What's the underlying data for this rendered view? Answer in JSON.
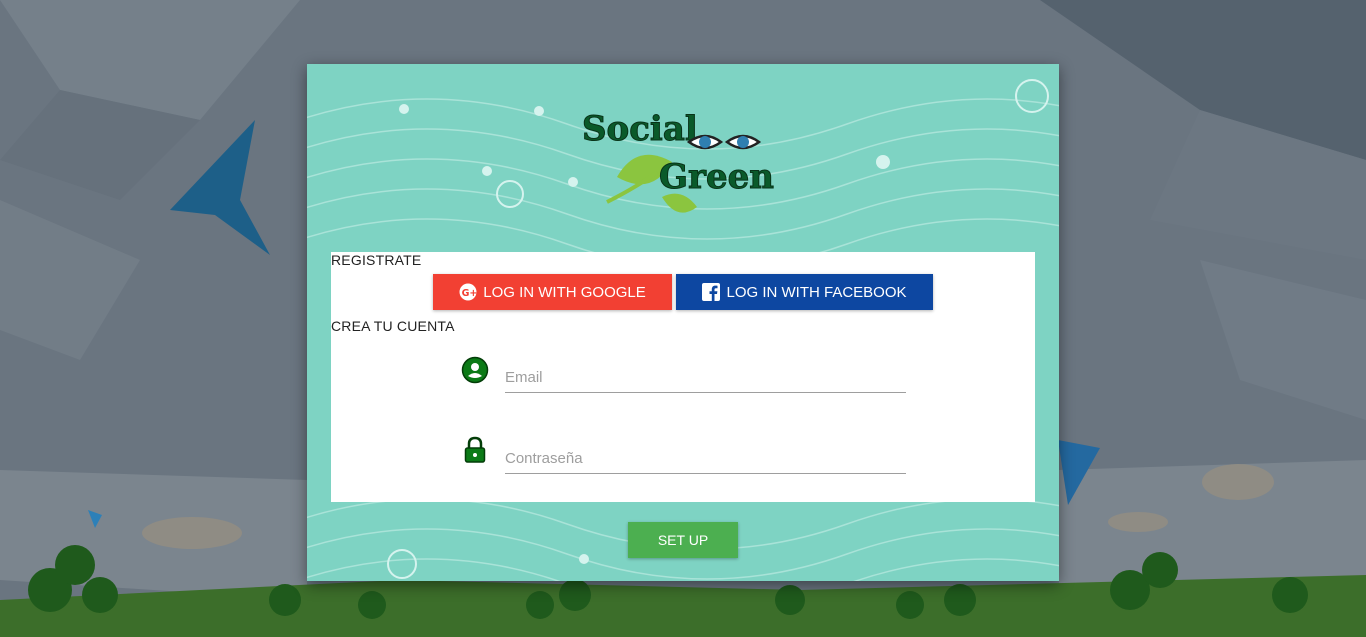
{
  "brand": {
    "line1": "Social",
    "line2": "Green"
  },
  "register": {
    "title": "REGISTRATE",
    "google_label": "LOG IN WITH GOOGLE",
    "facebook_label": "LOG IN WITH FACEBOOK",
    "google_icon": "google-plus-icon",
    "facebook_icon": "facebook-icon"
  },
  "create_account": {
    "title": "CREA TU CUENTA",
    "email": {
      "placeholder": "Email",
      "value": "",
      "icon": "account-circle-icon"
    },
    "password": {
      "placeholder": "Contraseña",
      "value": "",
      "icon": "lock-icon"
    },
    "submit_label": "SET UP"
  },
  "colors": {
    "google": "#f24033",
    "facebook": "#0d47a1",
    "submit": "#4caf50",
    "modal_bg": "#7ed3c3",
    "icon_green": "#0b7a16"
  }
}
